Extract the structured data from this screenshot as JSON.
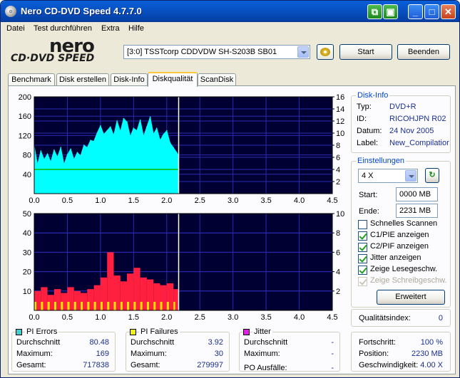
{
  "window": {
    "title": "Nero CD-DVD Speed 4.7.7.0",
    "buttons": {
      "minimize": "_",
      "maximize": "□",
      "close": "✕"
    }
  },
  "menu": [
    "Datei",
    "Test durchführen",
    "Extra",
    "Hilfe"
  ],
  "logo": {
    "brand": "nero",
    "product": "CD·DVD SPEED"
  },
  "toolbar": {
    "drive": "[3:0]  TSSTcorp CDDVDW SH-S203B SB01",
    "start_label": "Start",
    "exit_label": "Beenden"
  },
  "tabs": [
    "Benchmark",
    "Disk erstellen",
    "Disk-Info",
    "Diskqualität",
    "ScanDisk"
  ],
  "active_tab": "Diskqualität",
  "disk_info": {
    "title": "Disk-Info",
    "rows": [
      {
        "label": "Typ:",
        "value": "DVD+R"
      },
      {
        "label": "ID:",
        "value": "RICOHJPN R02"
      },
      {
        "label": "Datum:",
        "value": "24 Nov 2005"
      },
      {
        "label": "Label:",
        "value": "New_Compilatior"
      }
    ]
  },
  "settings": {
    "title": "Einstellungen",
    "speed": "4 X",
    "start_label": "Start:",
    "start_value": "0000 MB",
    "end_label": "Ende:",
    "end_value": "2231 MB",
    "checkboxes": [
      {
        "label": "Schnelles Scannen",
        "checked": false,
        "disabled": false
      },
      {
        "label": "C1/PIE anzeigen",
        "checked": true,
        "disabled": false
      },
      {
        "label": "C2/PIF anzeigen",
        "checked": true,
        "disabled": false
      },
      {
        "label": "Jitter anzeigen",
        "checked": true,
        "disabled": false
      },
      {
        "label": "Zeige Lesegeschw.",
        "checked": true,
        "disabled": false
      },
      {
        "label": "Zeige Schreibgeschw.",
        "checked": true,
        "disabled": true
      }
    ],
    "advanced_label": "Erweitert"
  },
  "quality": {
    "label": "Qualitätsindex:",
    "value": "0"
  },
  "progress": {
    "rows": [
      {
        "label": "Fortschritt:",
        "value": "100 %"
      },
      {
        "label": "Position:",
        "value": "2230 MB"
      },
      {
        "label": "Geschwindigkeit:",
        "value": "4.00 X"
      }
    ]
  },
  "stats": {
    "pi_errors": {
      "title": "PI Errors",
      "color": "#40d0d0",
      "rows": [
        {
          "label": "Durchschnitt",
          "value": "80.48"
        },
        {
          "label": "Maximum:",
          "value": "169"
        },
        {
          "label": "Gesamt:",
          "value": "717838"
        }
      ]
    },
    "pi_failures": {
      "title": "PI Failures",
      "color": "#f0f020",
      "rows": [
        {
          "label": "Durchschnitt",
          "value": "3.92"
        },
        {
          "label": "Maximum:",
          "value": "30"
        },
        {
          "label": "Gesamt:",
          "value": "279997"
        }
      ]
    },
    "jitter": {
      "title": "Jitter",
      "color": "#e020e0",
      "rows": [
        {
          "label": "Durchschnitt",
          "value": "-"
        },
        {
          "label": "Maximum:",
          "value": "-"
        }
      ],
      "po_label": "PO Ausfälle:",
      "po_value": "-"
    }
  },
  "chart_data": [
    {
      "type": "area",
      "name": "PI Errors chart",
      "x_ticks": [
        "0.0",
        "0.5",
        "1.0",
        "1.5",
        "2.0",
        "2.5",
        "3.0",
        "3.5",
        "4.0",
        "4.5"
      ],
      "xlim": [
        0,
        4.5
      ],
      "y_left_ticks": [
        "40",
        "80",
        "120",
        "160",
        "200"
      ],
      "ylim_left": [
        0,
        200
      ],
      "y_right_ticks": [
        "2",
        "4",
        "6",
        "8",
        "10",
        "12",
        "14",
        "16"
      ],
      "ylim_right": [
        0,
        16
      ],
      "scan_end": 2.18,
      "colors": {
        "bg": "#000033",
        "grid": "#2a2ab0",
        "area": "#00ffff",
        "speed": "#00c000",
        "marker": "#ffffff"
      },
      "series": [
        {
          "name": "PI Errors",
          "x": [
            0.0,
            0.05,
            0.1,
            0.15,
            0.2,
            0.25,
            0.3,
            0.35,
            0.4,
            0.45,
            0.5,
            0.55,
            0.6,
            0.65,
            0.7,
            0.75,
            0.8,
            0.85,
            0.9,
            0.95,
            1.0,
            1.05,
            1.1,
            1.15,
            1.2,
            1.25,
            1.3,
            1.35,
            1.4,
            1.45,
            1.5,
            1.55,
            1.6,
            1.65,
            1.7,
            1.75,
            1.8,
            1.85,
            1.9,
            1.95,
            2.0,
            2.05,
            2.1,
            2.15,
            2.18
          ],
          "values": [
            98,
            60,
            88,
            70,
            82,
            65,
            90,
            75,
            95,
            60,
            80,
            92,
            70,
            85,
            78,
            100,
            95,
            110,
            108,
            125,
            140,
            122,
            130,
            138,
            120,
            150,
            128,
            155,
            148,
            118,
            135,
            130,
            152,
            118,
            138,
            158,
            122,
            135,
            110,
            122,
            130,
            105,
            95,
            85,
            78
          ]
        },
        {
          "name": "Read speed",
          "x": [
            0.0,
            2.18
          ],
          "values": [
            4.0,
            4.0
          ]
        }
      ]
    },
    {
      "type": "bar",
      "name": "PI Failures chart",
      "x_ticks": [
        "0.0",
        "0.5",
        "1.0",
        "1.5",
        "2.0",
        "2.5",
        "3.0",
        "3.5",
        "4.0",
        "4.5"
      ],
      "xlim": [
        0,
        4.5
      ],
      "y_left_ticks": [
        "10",
        "20",
        "30",
        "40",
        "50"
      ],
      "ylim_left": [
        0,
        50
      ],
      "y_right_ticks": [
        "2",
        "4",
        "6",
        "8",
        "10"
      ],
      "ylim_right": [
        0,
        10
      ],
      "scan_end": 2.18,
      "colors": {
        "bg": "#000033",
        "grid": "#2a2ab0",
        "bars": "#ff2040",
        "bars_hi": "#ffe000",
        "marker": "#ffffff"
      },
      "series": [
        {
          "name": "PI Failures",
          "x": [
            0.0,
            0.1,
            0.2,
            0.3,
            0.4,
            0.5,
            0.6,
            0.7,
            0.8,
            0.9,
            1.0,
            1.1,
            1.2,
            1.3,
            1.4,
            1.5,
            1.6,
            1.7,
            1.8,
            1.9,
            2.0,
            2.1,
            2.18
          ],
          "values": [
            10,
            12,
            8,
            11,
            9,
            12,
            10,
            9,
            11,
            13,
            17,
            30,
            18,
            15,
            19,
            22,
            17,
            16,
            14,
            13,
            14,
            11,
            9
          ]
        }
      ]
    }
  ]
}
